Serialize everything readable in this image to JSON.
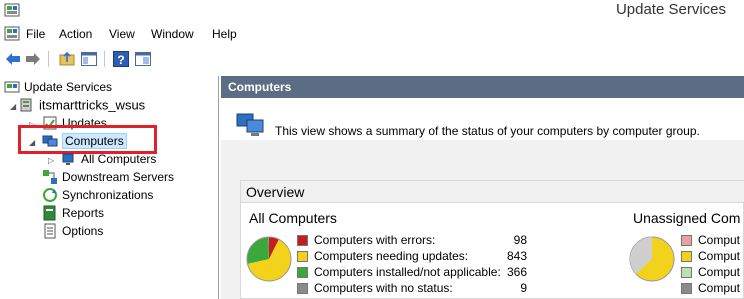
{
  "window": {
    "title": "Update Services"
  },
  "menu": {
    "items": [
      "File",
      "Action",
      "View",
      "Window",
      "Help"
    ]
  },
  "icons": {
    "app": "wsus-app-icon",
    "back": "back-arrow-icon",
    "forward": "forward-arrow-icon",
    "up": "up-folder-icon",
    "show_hide_tree": "console-tree-icon",
    "help": "help-icon",
    "properties": "properties-pane-icon"
  },
  "tree": {
    "root": "Update Services",
    "server": "itsmarttricks_wsus",
    "updates": "Updates",
    "computers": "Computers",
    "all_computers": "All Computers",
    "downstream": "Downstream Servers",
    "synchronizations": "Synchronizations",
    "reports": "Reports",
    "options": "Options"
  },
  "main": {
    "header": "Computers",
    "description": "This view shows a summary of the status of your computers by computer group.",
    "overview_title": "Overview",
    "all_computers": {
      "title": "All Computers",
      "legend": [
        {
          "label": "Computers with errors:",
          "value": "98",
          "color": "#c41e1e"
        },
        {
          "label": "Computers needing updates:",
          "value": "843",
          "color": "#f2d21b"
        },
        {
          "label": "Computers installed/not applicable:",
          "value": "366",
          "color": "#3aa83a"
        },
        {
          "label": "Computers with no status:",
          "value": "9",
          "color": "#8a8a8a"
        }
      ]
    },
    "unassigned": {
      "title": "Unassigned Com",
      "legend": [
        {
          "label": "Comput",
          "color": "#e8a0a0"
        },
        {
          "label": "Comput",
          "color": "#f2d21b"
        },
        {
          "label": "Comput",
          "color": "#b6e3b0"
        },
        {
          "label": "Comput",
          "color": "#8a8a8a"
        }
      ]
    }
  },
  "chart_data": [
    {
      "type": "pie",
      "title": "All Computers",
      "categories": [
        "Computers with errors",
        "Computers needing updates",
        "Computers installed/not applicable",
        "Computers with no status"
      ],
      "values": [
        98,
        843,
        366,
        9
      ],
      "colors": [
        "#c41e1e",
        "#f2d21b",
        "#3aa83a",
        "#8a8a8a"
      ]
    }
  ]
}
